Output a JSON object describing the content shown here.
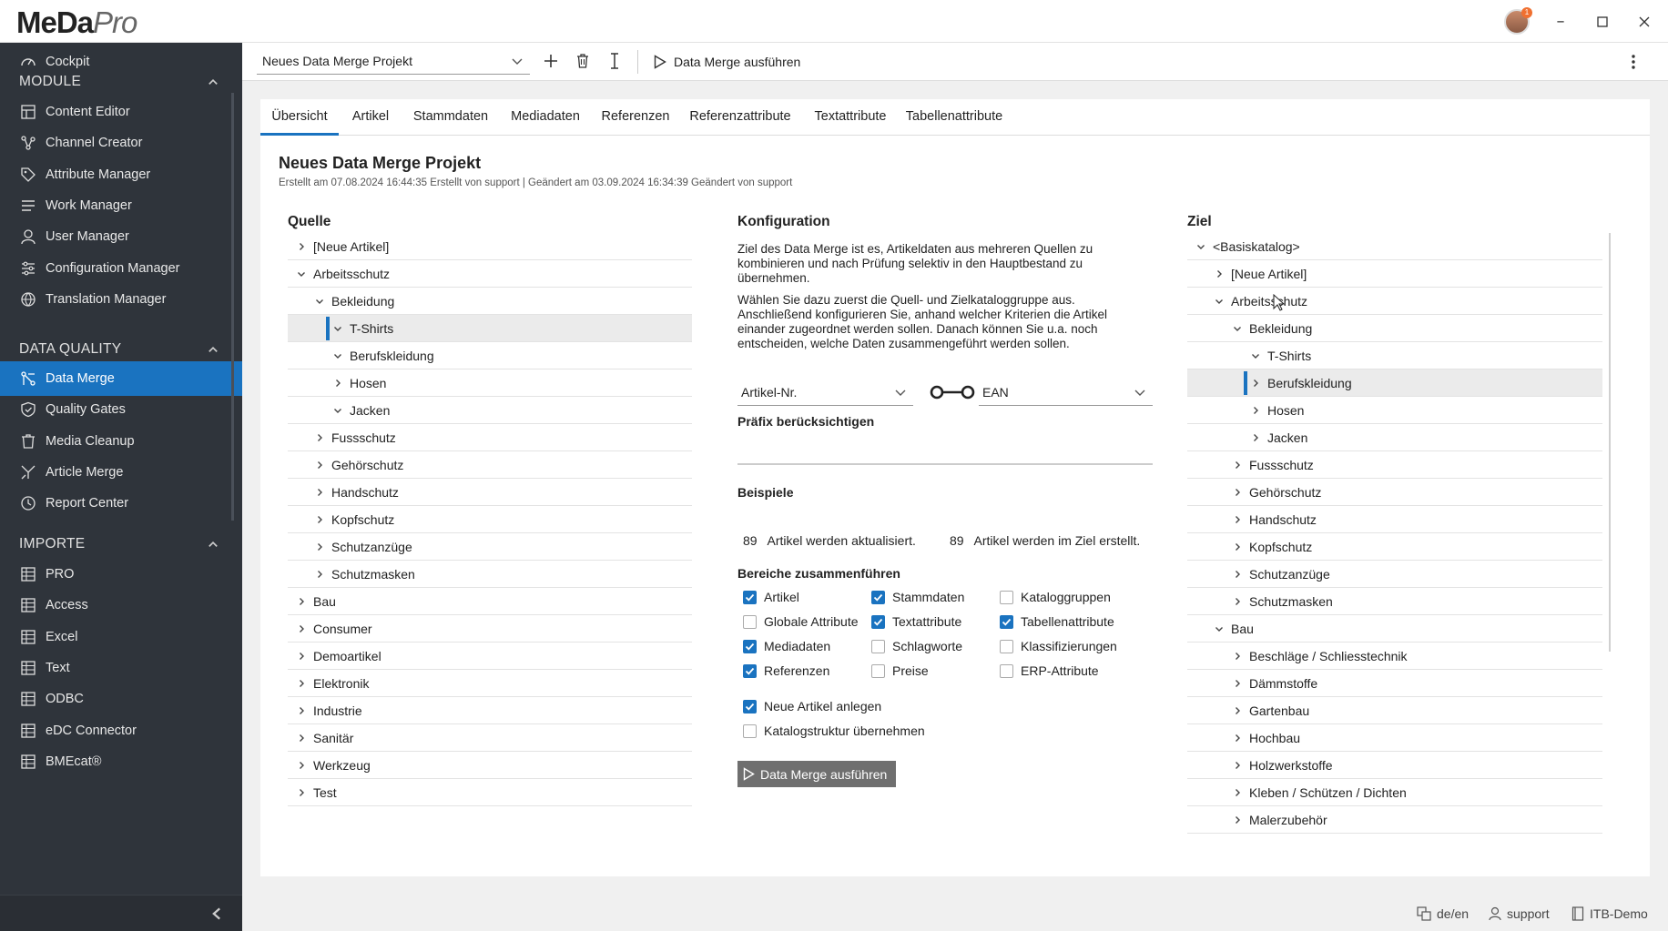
{
  "app": {
    "logo_main": "MeDa",
    "logo_italic": "Pro",
    "notification_count": "1"
  },
  "sidebar": {
    "top_item": {
      "label": "Cockpit",
      "icon": "gauge-icon"
    },
    "sections": [
      {
        "title": "MODULE",
        "items": [
          {
            "label": "Content Editor",
            "icon": "grid-icon"
          },
          {
            "label": "Channel Creator",
            "icon": "network-icon"
          },
          {
            "label": "Attribute Manager",
            "icon": "tag-icon"
          },
          {
            "label": "Work Manager",
            "icon": "list-icon"
          },
          {
            "label": "User Manager",
            "icon": "user-icon"
          },
          {
            "label": "Configuration Manager",
            "icon": "sliders-icon"
          },
          {
            "label": "Translation Manager",
            "icon": "globe-icon"
          }
        ]
      },
      {
        "title": "DATA QUALITY",
        "items": [
          {
            "label": "Data Merge",
            "icon": "merge-icon",
            "active": true
          },
          {
            "label": "Quality Gates",
            "icon": "shield-icon"
          },
          {
            "label": "Media Cleanup",
            "icon": "trash-icon"
          },
          {
            "label": "Article Merge",
            "icon": "merge-arrows-icon"
          },
          {
            "label": "Report Center",
            "icon": "clock-icon"
          }
        ]
      },
      {
        "title": "IMPORTE",
        "items": [
          {
            "label": "PRO",
            "icon": "import-icon"
          },
          {
            "label": "Access",
            "icon": "import-icon"
          },
          {
            "label": "Excel",
            "icon": "import-icon"
          },
          {
            "label": "Text",
            "icon": "import-icon"
          },
          {
            "label": "ODBC",
            "icon": "import-icon"
          },
          {
            "label": "eDC Connector",
            "icon": "import-icon"
          },
          {
            "label": "BMEcat®",
            "icon": "import-icon"
          }
        ]
      }
    ]
  },
  "toolbar": {
    "project": "Neues Data Merge Projekt",
    "run_label": "Data Merge ausführen"
  },
  "tabs": [
    "Übersicht",
    "Artikel",
    "Stammdaten",
    "Mediadaten",
    "Referenzen",
    "Referenzattribute",
    "Textattribute",
    "Tabellenattribute"
  ],
  "project": {
    "title": "Neues Data Merge Projekt",
    "meta": "Erstellt am 07.08.2024 16:44:35 Erstellt von support | Geändert am 03.09.2024 16:34:39 Geändert von support"
  },
  "source": {
    "title": "Quelle",
    "rows": [
      {
        "label": "[Neue Artikel]",
        "level": 0,
        "open": false
      },
      {
        "label": "Arbeitsschutz",
        "level": 0,
        "open": true
      },
      {
        "label": "Bekleidung",
        "level": 1,
        "open": true
      },
      {
        "label": "T-Shirts",
        "level": 2,
        "open": true,
        "selected": true
      },
      {
        "label": "Berufskleidung",
        "level": 2,
        "open": true
      },
      {
        "label": "Hosen",
        "level": 2,
        "open": false
      },
      {
        "label": "Jacken",
        "level": 2,
        "open": true
      },
      {
        "label": "Fussschutz",
        "level": 1,
        "open": false
      },
      {
        "label": "Gehörschutz",
        "level": 1,
        "open": false
      },
      {
        "label": "Handschutz",
        "level": 1,
        "open": false
      },
      {
        "label": "Kopfschutz",
        "level": 1,
        "open": false
      },
      {
        "label": "Schutzanzüge",
        "level": 1,
        "open": false
      },
      {
        "label": "Schutzmasken",
        "level": 1,
        "open": false
      },
      {
        "label": "Bau",
        "level": 0,
        "open": false
      },
      {
        "label": "Consumer",
        "level": 0,
        "open": false
      },
      {
        "label": "Demoartikel",
        "level": 0,
        "open": false
      },
      {
        "label": "Elektronik",
        "level": 0,
        "open": false
      },
      {
        "label": "Industrie",
        "level": 0,
        "open": false
      },
      {
        "label": "Sanitär",
        "level": 0,
        "open": false
      },
      {
        "label": "Werkzeug",
        "level": 0,
        "open": false
      },
      {
        "label": "Test",
        "level": 0,
        "open": false
      }
    ]
  },
  "config": {
    "title": "Konfiguration",
    "intro1": "Ziel des Data Merge ist es, Artikeldaten aus mehreren Quellen zu kombinieren und nach Prüfung selektiv in den Hauptbestand zu übernehmen.",
    "intro2": "Wählen Sie dazu zuerst die Quell- und Zielkataloggruppe aus. Anschließend konfigurieren Sie, anhand welcher Kriterien die Artikel einander zugeordnet werden sollen. Danach können Sie u.a. noch entscheiden, welche Daten zusammengeführt werden sollen.",
    "source_key": "Artikel-Nr.",
    "target_key": "EAN",
    "prefix_label": "Präfix berücksichtigen",
    "examples_label": "Beispiele",
    "updated_count": "89",
    "updated_text": "Artikel werden aktualisiert.",
    "created_count": "89",
    "created_text": "Artikel werden im Ziel erstellt.",
    "areas_label": "Bereiche zusammenführen",
    "areas": [
      {
        "label": "Artikel",
        "checked": true
      },
      {
        "label": "Stammdaten",
        "checked": true
      },
      {
        "label": "Kataloggruppen",
        "checked": false
      },
      {
        "label": "Globale Attribute",
        "checked": false
      },
      {
        "label": "Textattribute",
        "checked": true
      },
      {
        "label": "Tabellenattribute",
        "checked": true
      },
      {
        "label": "Mediadaten",
        "checked": true
      },
      {
        "label": "Schlagworte",
        "checked": false
      },
      {
        "label": "Klassifizierungen",
        "checked": false
      },
      {
        "label": "Referenzen",
        "checked": true
      },
      {
        "label": "Preise",
        "checked": false
      },
      {
        "label": "ERP-Attribute",
        "checked": false
      }
    ],
    "options": [
      {
        "label": "Neue Artikel anlegen",
        "checked": true
      },
      {
        "label": "Katalogstruktur übernehmen",
        "checked": false
      }
    ],
    "run_button": "Data Merge ausführen"
  },
  "target": {
    "title": "Ziel",
    "rows": [
      {
        "label": "<Basiskatalog>",
        "level": 0,
        "open": true
      },
      {
        "label": "[Neue Artikel]",
        "level": 1,
        "open": false
      },
      {
        "label": "Arbeitsschutz",
        "level": 1,
        "open": true
      },
      {
        "label": "Bekleidung",
        "level": 2,
        "open": true
      },
      {
        "label": "T-Shirts",
        "level": 3,
        "open": true
      },
      {
        "label": "Berufskleidung",
        "level": 3,
        "open": false,
        "selected": true
      },
      {
        "label": "Hosen",
        "level": 3,
        "open": false
      },
      {
        "label": "Jacken",
        "level": 3,
        "open": false
      },
      {
        "label": "Fussschutz",
        "level": 2,
        "open": false
      },
      {
        "label": "Gehörschutz",
        "level": 2,
        "open": false
      },
      {
        "label": "Handschutz",
        "level": 2,
        "open": false
      },
      {
        "label": "Kopfschutz",
        "level": 2,
        "open": false
      },
      {
        "label": "Schutzanzüge",
        "level": 2,
        "open": false
      },
      {
        "label": "Schutzmasken",
        "level": 2,
        "open": false
      },
      {
        "label": "Bau",
        "level": 1,
        "open": true
      },
      {
        "label": "Beschläge / Schliesstechnik",
        "level": 2,
        "open": false
      },
      {
        "label": "Dämmstoffe",
        "level": 2,
        "open": false
      },
      {
        "label": "Gartenbau",
        "level": 2,
        "open": false
      },
      {
        "label": "Hochbau",
        "level": 2,
        "open": false
      },
      {
        "label": "Holzwerkstoffe",
        "level": 2,
        "open": false
      },
      {
        "label": "Kleben / Schützen / Dichten",
        "level": 2,
        "open": false
      },
      {
        "label": "Malerzubehör",
        "level": 2,
        "open": false
      }
    ]
  },
  "statusbar": {
    "language": "de/en",
    "user": "support",
    "environment": "ITB-Demo"
  },
  "colors": {
    "accent": "#1a73c0",
    "sidebar_bg": "#2f343b",
    "button_bg": "#6f6f6f"
  }
}
